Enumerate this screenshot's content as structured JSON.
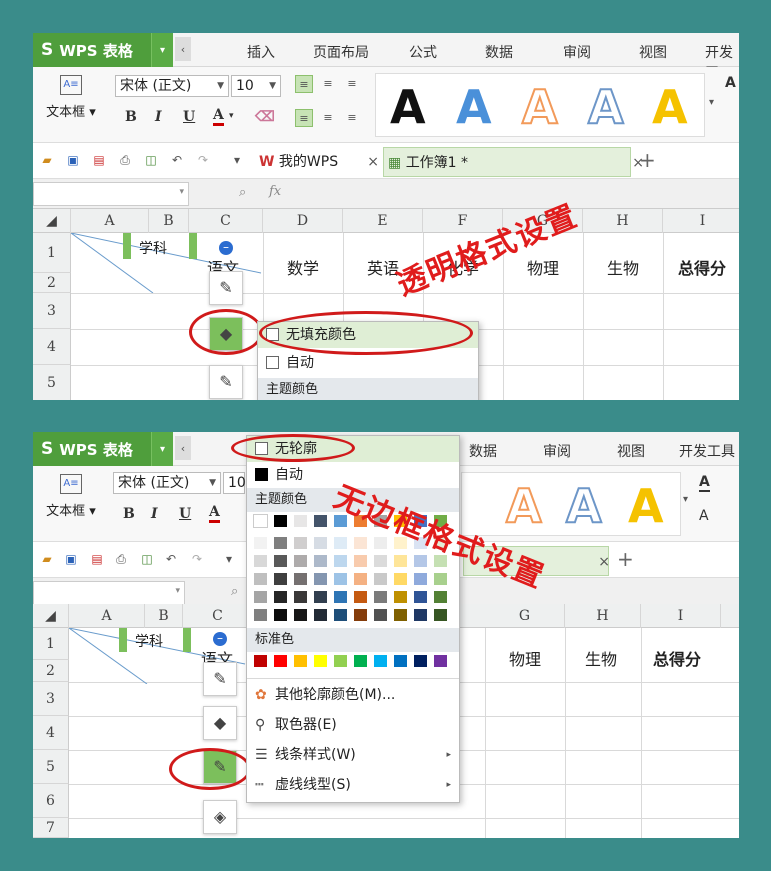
{
  "app": {
    "logo_glyph": "S",
    "logo_text": "WPS 表格",
    "dropdown_glyph": "▾",
    "collapse_glyph": "‹"
  },
  "menu": [
    "插入",
    "页面布局",
    "公式",
    "数据",
    "审阅",
    "视图",
    "开发工"
  ],
  "menu_p2": [
    "数据",
    "审阅",
    "视图",
    "开发工具"
  ],
  "ribbon": {
    "textbox_label": "文本框",
    "font_name": "宋体 (正文)",
    "font_size": "10",
    "bold": "B",
    "italic": "I",
    "underline": "U",
    "font_color": "A",
    "style_letter": "A",
    "style_colors": [
      "#111111",
      "#4a90d9",
      "#f29a5a",
      "#6d96c8",
      "#f5c200"
    ]
  },
  "tabs": {
    "my_wps": "我的WPS",
    "workbook": "工作簿1 *",
    "close": "×",
    "new": "+"
  },
  "formula": {
    "fx": "fx",
    "zoom": "⌕"
  },
  "columns": [
    "A",
    "B",
    "C",
    "D",
    "E",
    "F",
    "G",
    "H",
    "I"
  ],
  "rows": [
    "1",
    "2",
    "3",
    "4",
    "5",
    "6",
    "7"
  ],
  "headers": [
    "学科",
    "语文",
    "数学",
    "英语",
    "化学",
    "物理",
    "生物",
    "总得分"
  ],
  "panel1": {
    "annotation": "透明格式设置",
    "fill_menu": {
      "no_fill": "无填充颜色",
      "auto": "自动",
      "theme": "主题颜色"
    }
  },
  "panel2": {
    "annotation": "无边框格式设置",
    "outline_menu": {
      "no_outline": "无轮廓",
      "auto": "自动",
      "theme": "主题颜色",
      "standard": "标准色",
      "more": "其他轮廓颜色(M)...",
      "picker": "取色器(E)",
      "line_style": "线条样式(W)",
      "dash": "虚线线型(S)"
    },
    "theme_top": [
      "#ffffff",
      "#000000",
      "#e7e6e6",
      "#44546a",
      "#5b9bd5",
      "#ed7d31",
      "#a5a5a5",
      "#ffc000",
      "#4472c4",
      "#70ad47"
    ],
    "theme_shades": [
      [
        "#f2f2f2",
        "#7f7f7f",
        "#d0cece",
        "#d6dce4",
        "#deebf6",
        "#fbe5d5",
        "#ededed",
        "#fff2cc",
        "#dae3f3",
        "#e2efd9"
      ],
      [
        "#d8d8d8",
        "#595959",
        "#aeabab",
        "#adb9ca",
        "#bdd7ee",
        "#f8cbad",
        "#dbdbdb",
        "#fee599",
        "#b4c7e7",
        "#c5e0b3"
      ],
      [
        "#bfbfbf",
        "#3f3f3f",
        "#757070",
        "#8496b0",
        "#9dc3e6",
        "#f4b183",
        "#c9c9c9",
        "#ffd965",
        "#8faadc",
        "#a8d08d"
      ],
      [
        "#a5a5a5",
        "#262626",
        "#3a3838",
        "#323f4f",
        "#2e75b5",
        "#c55a11",
        "#7b7b7b",
        "#bf9000",
        "#2f5496",
        "#538135"
      ],
      [
        "#7f7f7f",
        "#0c0c0c",
        "#171616",
        "#222a35",
        "#1e4e79",
        "#843c0b",
        "#525252",
        "#7f6000",
        "#1f3864",
        "#375623"
      ]
    ],
    "standard_colors": [
      "#c00000",
      "#ff0000",
      "#ffc000",
      "#ffff00",
      "#92d050",
      "#00b050",
      "#00b0f0",
      "#0070c0",
      "#002060",
      "#7030a0"
    ]
  }
}
